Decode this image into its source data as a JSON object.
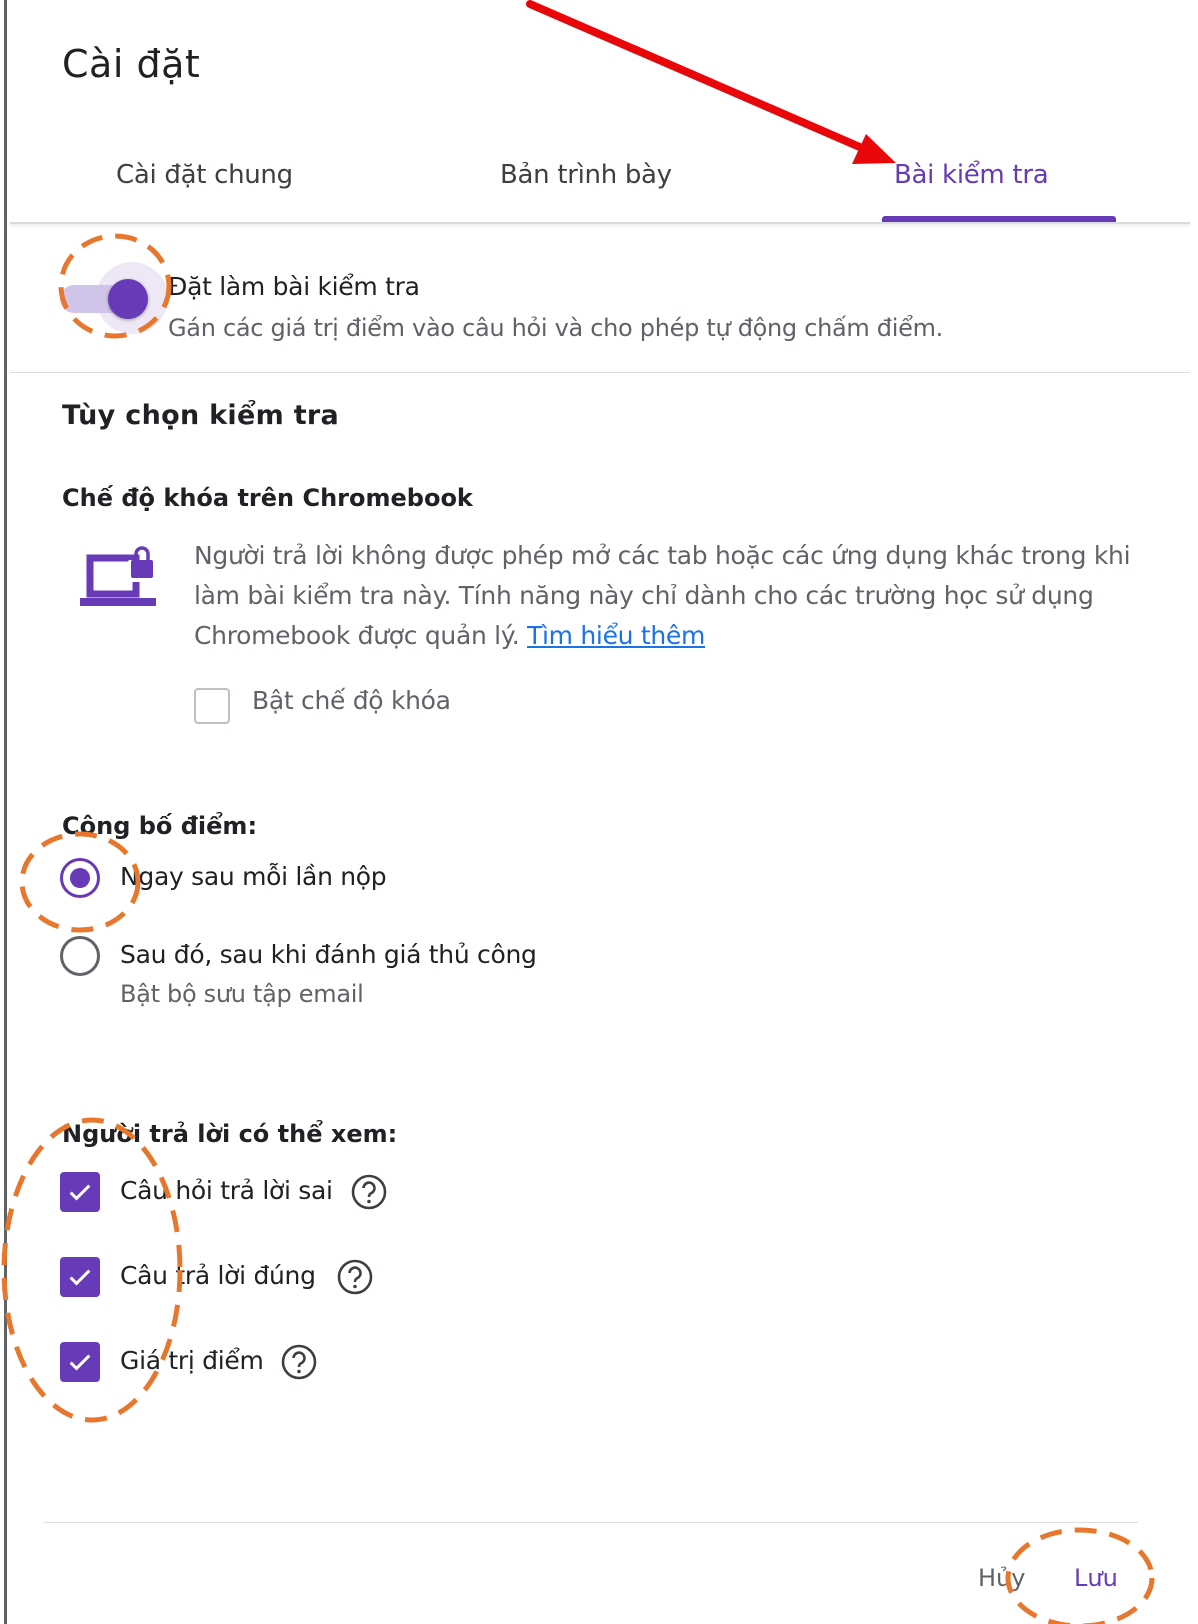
{
  "dialog": {
    "title": "Cài đặt"
  },
  "tabs": [
    {
      "label": "Cài đặt chung",
      "active": false
    },
    {
      "label": "Bản trình bày",
      "active": false
    },
    {
      "label": "Bài kiểm tra",
      "active": true
    }
  ],
  "quiz": {
    "toggle_on": true,
    "label": "Đặt làm bài kiểm tra",
    "description": "Gán các giá trị điểm vào câu hỏi và cho phép tự động chấm điểm."
  },
  "options": {
    "heading": "Tùy chọn kiểm tra",
    "lock_mode": {
      "heading": "Chế độ khóa trên Chromebook",
      "description": "Người trả lời không được phép mở các tab hoặc các ứng dụng khác trong khi làm bài kiểm tra này. Tính năng này chỉ dành cho các trường học sử dụng Chromebook được quản lý.",
      "link": "Tìm hiểu thêm",
      "checkbox_label": "Bật chế độ khóa",
      "checked": false
    }
  },
  "release": {
    "heading": "Công bố điểm:",
    "options": [
      {
        "label": "Ngay sau mỗi lần nộp",
        "sub": "",
        "selected": true
      },
      {
        "label": "Sau đó, sau khi đánh giá thủ công",
        "sub": "Bật bộ sưu tập email",
        "selected": false
      }
    ]
  },
  "respondent_view": {
    "heading": "Người trả lời có thể xem:",
    "items": [
      {
        "label": "Câu hỏi trả lời sai",
        "checked": true
      },
      {
        "label": "Câu trả lời đúng",
        "checked": true
      },
      {
        "label": "Giá trị điểm",
        "checked": true
      }
    ]
  },
  "footer": {
    "cancel_label": "Hủy",
    "save_label": "Lưu"
  },
  "colors": {
    "accent": "#673ab7",
    "link": "#1a73e8",
    "annotation_arrow": "#e8060a",
    "annotation_circle": "#e8772e"
  },
  "icons": [
    "laptop-lock-icon",
    "help-icon",
    "check-icon",
    "arrow-annotation",
    "dashed-circle-annotation"
  ]
}
